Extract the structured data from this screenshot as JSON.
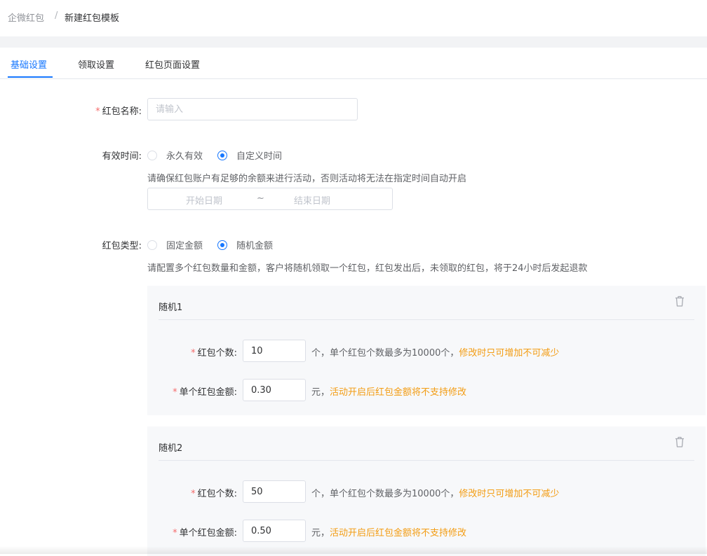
{
  "breadcrumb": {
    "root": "企微红包",
    "separator": "/",
    "current": "新建红包模板"
  },
  "tabs": [
    {
      "label": "基础设置",
      "active": true
    },
    {
      "label": "领取设置",
      "active": false
    },
    {
      "label": "红包页面设置",
      "active": false
    }
  ],
  "form": {
    "name": {
      "required_mark": "*",
      "label": "红包名称:",
      "placeholder": "请输入",
      "value": ""
    },
    "validity": {
      "label": "有效时间:",
      "options": [
        {
          "label": "永久有效",
          "checked": false
        },
        {
          "label": "自定义时间",
          "checked": true
        }
      ],
      "tip": "请确保红包账户有足够的余额来进行活动，否则活动将无法在指定时间自动开启",
      "start_placeholder": "开始日期",
      "range_separator": "~",
      "end_placeholder": "结束日期"
    },
    "type": {
      "label": "红包类型:",
      "options": [
        {
          "label": "固定金额",
          "checked": false
        },
        {
          "label": "随机金额",
          "checked": true
        }
      ],
      "tip": "请配置多个红包数量和金额，客户将随机领取一个红包，红包发出后，未领取的红包，将于24小时后发起退款"
    }
  },
  "random_items": [
    {
      "title": "随机1",
      "count_label": "红包个数:",
      "count_value": "10",
      "count_note": "个，单个红包个数最多为10000个，",
      "count_warn": "修改时只可增加不可减少",
      "amount_label": "单个红包金额:",
      "amount_value": "0.30",
      "amount_note": "元，",
      "amount_warn": "活动开启后红包金额将不支持修改"
    },
    {
      "title": "随机2",
      "count_label": "红包个数:",
      "count_value": "50",
      "count_note": "个，单个红包个数最多为10000个，",
      "count_warn": "修改时只可增加不可减少",
      "amount_label": "单个红包金额:",
      "amount_value": "0.50",
      "amount_note": "元，",
      "amount_warn": "活动开启后红包金额将不支持修改"
    }
  ],
  "colors": {
    "primary": "#1677ff",
    "required": "#f56c6c",
    "warning": "#f39c12"
  },
  "icons": {
    "delete": "trash-icon"
  }
}
